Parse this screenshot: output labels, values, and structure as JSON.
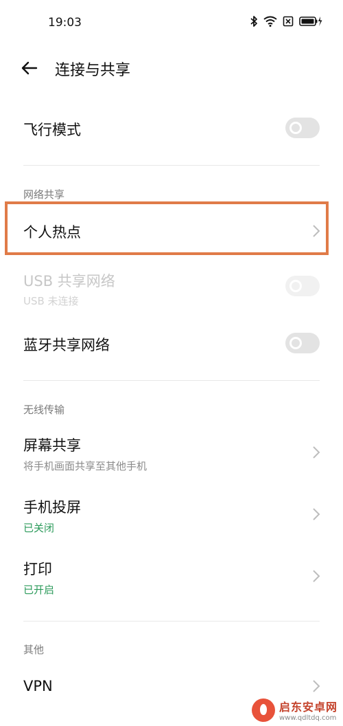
{
  "status_bar": {
    "time": "19:03",
    "icons": [
      "bluetooth-icon",
      "wifi-icon",
      "sim-off-icon",
      "battery-charging-icon"
    ]
  },
  "header": {
    "title": "连接与共享"
  },
  "airplane_mode": {
    "label": "飞行模式",
    "enabled": false
  },
  "sections": {
    "network_sharing": "网络共享",
    "wireless_transfer": "无线传输",
    "other": "其他"
  },
  "items": {
    "hotspot": {
      "label": "个人热点"
    },
    "usb_tethering": {
      "label": "USB 共享网络",
      "status": "USB 未连接",
      "enabled": false,
      "disabled": true
    },
    "bt_tethering": {
      "label": "蓝牙共享网络",
      "enabled": false
    },
    "screen_share": {
      "label": "屏幕共享",
      "status": "将手机画面共享至其他手机"
    },
    "screen_cast": {
      "label": "手机投屏",
      "status": "已关闭"
    },
    "print": {
      "label": "打印",
      "status": "已开启"
    },
    "vpn": {
      "label": "VPN"
    }
  },
  "colors": {
    "highlight": "#e07b48",
    "status_green": "#2b9a5a",
    "toggle_off": "#e3e3e3"
  },
  "watermark": {
    "name": "启东安卓网",
    "url": "www.qdltdq.com"
  }
}
